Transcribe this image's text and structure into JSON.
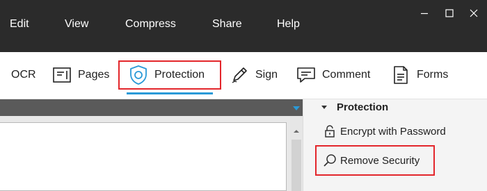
{
  "menu": {
    "items": [
      {
        "label": "Edit"
      },
      {
        "label": "View"
      },
      {
        "label": "Compress"
      },
      {
        "label": "Share"
      },
      {
        "label": "Help"
      }
    ]
  },
  "window_controls": {
    "minimize_icon": "minimize-icon",
    "maximize_icon": "maximize-icon",
    "close_icon": "close-icon"
  },
  "toolbar": {
    "ocr_label": "OCR",
    "pages_label": "Pages",
    "protection_label": "Protection",
    "sign_label": "Sign",
    "comment_label": "Comment",
    "forms_label": "Forms",
    "active_tab": "Protection"
  },
  "panel": {
    "title": "Protection",
    "encrypt_label": "Encrypt with Password",
    "remove_label": "Remove Security"
  },
  "colors": {
    "menubar_bg": "#2b2b2b",
    "accent_blue": "#2a9ad8",
    "highlight_red": "#e3262b",
    "panel_bg": "#f4f4f4"
  }
}
